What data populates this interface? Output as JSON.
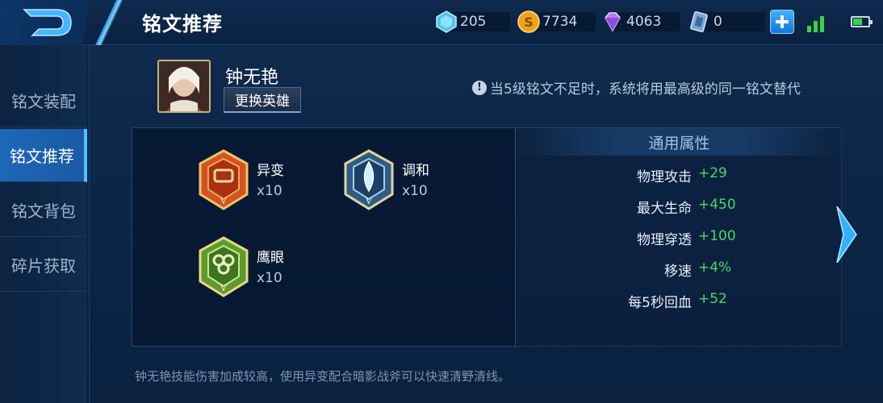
{
  "header": {
    "title": "铭文推荐",
    "currencies": [
      {
        "icon": "diamond-icon",
        "value": "205"
      },
      {
        "icon": "gold-coin-icon",
        "value": "7734"
      },
      {
        "icon": "purple-gem-icon",
        "value": "4063"
      },
      {
        "icon": "ticket-icon",
        "value": "0"
      }
    ]
  },
  "sidebar": {
    "items": [
      {
        "label": "铭文装配",
        "active": false
      },
      {
        "label": "铭文推荐",
        "active": true
      },
      {
        "label": "铭文背包",
        "active": false
      },
      {
        "label": "碎片获取",
        "active": false
      }
    ]
  },
  "hero": {
    "name": "钟无艳",
    "change_label": "更换英雄"
  },
  "notice": {
    "icon": "info-icon",
    "text": "当5级铭文不足时，系统将用最高级的同一铭文替代"
  },
  "runes": [
    {
      "name": "异变",
      "count": "x10",
      "color": "#c9471f"
    },
    {
      "name": "调和",
      "count": "x10",
      "color": "#2c5a86"
    },
    {
      "name": "鹰眼",
      "count": "x10",
      "color": "#4f8a2a"
    }
  ],
  "attributes": {
    "title": "通用属性",
    "rows": [
      {
        "label": "物理攻击",
        "value": "+29"
      },
      {
        "label": "最大生命",
        "value": "+450"
      },
      {
        "label": "物理穿透",
        "value": "+100"
      },
      {
        "label": "移速",
        "value": "+4%"
      },
      {
        "label": "每5秒回血",
        "value": "+52"
      }
    ]
  },
  "hint": "钟无艳技能伤害加成较高，使用异变配合暗影战斧可以快速清野清线。",
  "colors": {
    "accent": "#1d68b8",
    "positive": "#44d96e"
  }
}
